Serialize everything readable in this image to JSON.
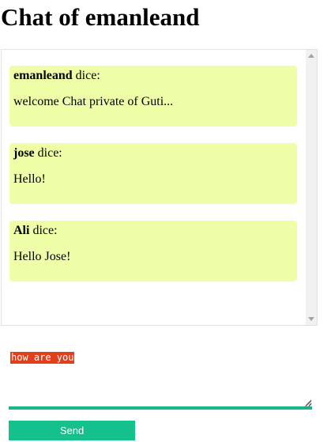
{
  "page": {
    "title": "Chat of emanleand"
  },
  "messages": [
    {
      "sender": "emanleand",
      "verb": " dice:",
      "text": "welcome Chat private of Guti..."
    },
    {
      "sender": "jose",
      "verb": " dice:",
      "text": "Hello!"
    },
    {
      "sender": "Ali",
      "verb": " dice:",
      "text": "Hello Jose!"
    }
  ],
  "composer": {
    "value": "how are you",
    "send_label": "Send"
  },
  "colors": {
    "message_bg": "#eeffa8",
    "accent": "#14c08c",
    "selection": "#e23f1d"
  }
}
